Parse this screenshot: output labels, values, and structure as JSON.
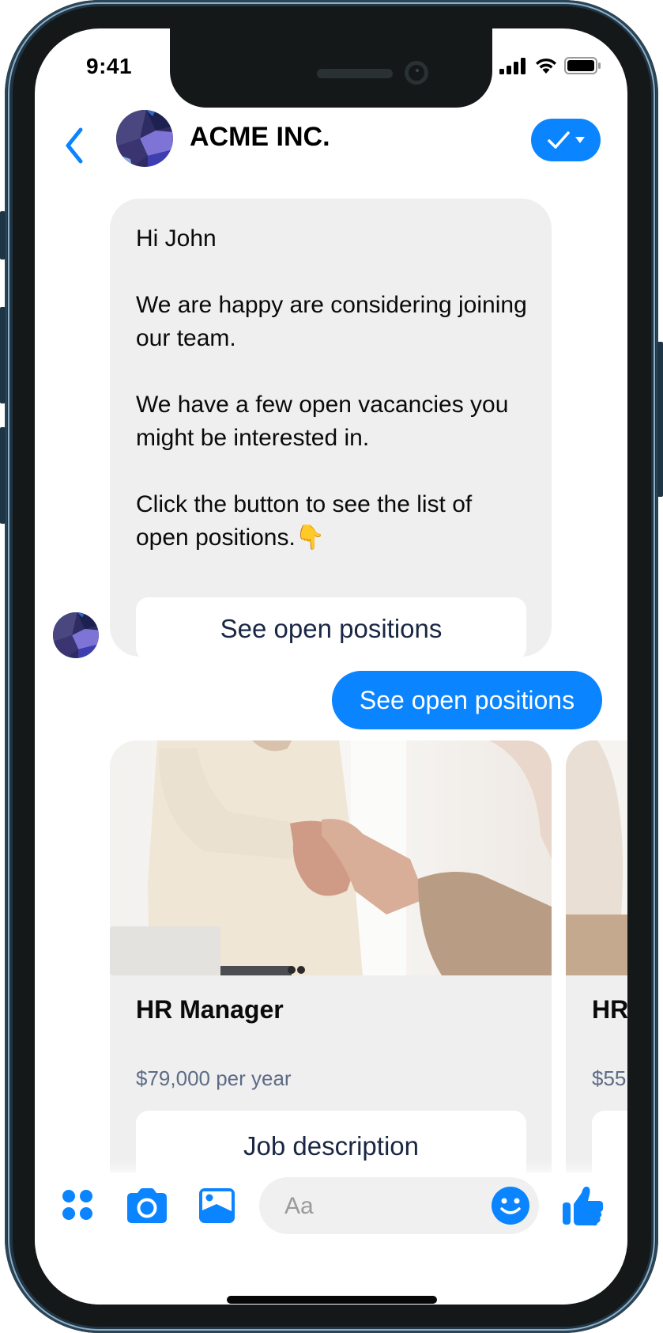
{
  "status_bar": {
    "time": "9:41",
    "icons": [
      "cellular-signal-icon",
      "wifi-icon",
      "battery-icon"
    ]
  },
  "header": {
    "back_icon": "chevron-left-icon",
    "title": "ACME INC.",
    "action_icon": "checkmark-dropdown-icon"
  },
  "conversation": {
    "bot_message": {
      "text": "Hi John\n\nWe are happy are considering joining our team.\n\nWe have a few open vacancies you might be interested in.\n\nClick the button to see the list of open positions.",
      "emoji": "👇",
      "button_label": "See open positions"
    },
    "user_message": {
      "text": "See open positions"
    },
    "job_cards": [
      {
        "image": "handshake-photo",
        "title": "HR Manager",
        "salary": "$79,000 per year",
        "button_label": "Job description"
      },
      {
        "image": "handshake-photo",
        "title": "HR",
        "salary": "$55",
        "button_label": ""
      }
    ]
  },
  "composer": {
    "icons": [
      "apps-grid-icon",
      "camera-icon",
      "photo-gallery-icon",
      "emoji-smiley-icon",
      "thumbs-up-icon"
    ],
    "input_placeholder": "Aa",
    "input_value": ""
  },
  "colors": {
    "accent": "#0a84ff",
    "bubble_gray": "#efefef",
    "button_text": "#1a2744",
    "price_text": "#5d6b85",
    "bezel": "#141819",
    "frame": "#1f3444"
  }
}
